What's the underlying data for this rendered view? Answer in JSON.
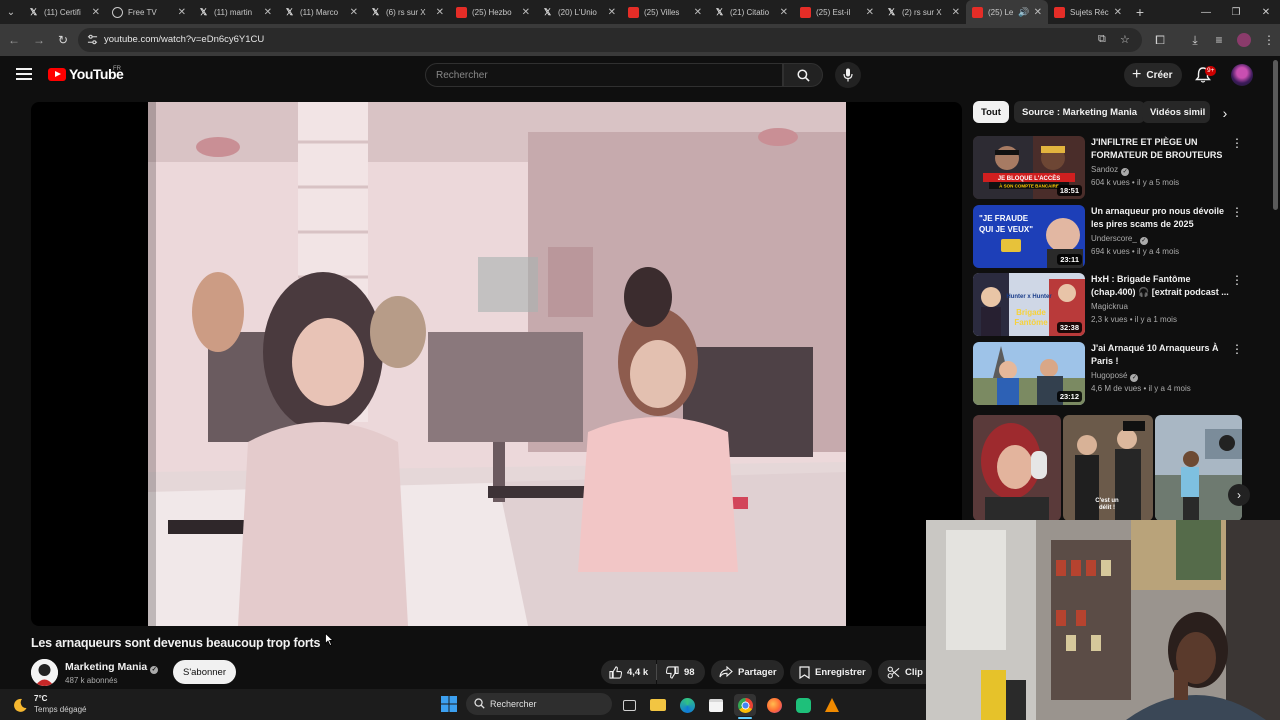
{
  "browser": {
    "tabs": [
      {
        "title": "(11) Certifi",
        "favicon": "x-logo-icon"
      },
      {
        "title": "Free TV",
        "favicon": "globe-icon"
      },
      {
        "title": "(11) martin",
        "favicon": "x-logo-icon"
      },
      {
        "title": "(11) Marco",
        "favicon": "x-logo-icon"
      },
      {
        "title": "(6) rs sur X",
        "favicon": "x-logo-icon"
      },
      {
        "title": "(25) Hezbo",
        "favicon": "youtube-icon"
      },
      {
        "title": "(20) L'Unio",
        "favicon": "x-logo-icon"
      },
      {
        "title": "(25) Villes",
        "favicon": "youtube-icon"
      },
      {
        "title": "(21) Citatio",
        "favicon": "x-logo-icon"
      },
      {
        "title": "(25) Est-il",
        "favicon": "youtube-icon"
      },
      {
        "title": "(2) rs sur X",
        "favicon": "x-logo-icon"
      },
      {
        "title": "(25) Le",
        "favicon": "youtube-icon",
        "active": true
      },
      {
        "title": "Sujets Réc",
        "favicon": "youtube-icon"
      }
    ],
    "url": "youtube.com/watch?v=eDn6cy6Y1CU"
  },
  "youtube": {
    "logo_text": "YouTube",
    "country_code": "FR",
    "search_placeholder": "Rechercher",
    "create_label": "Créer",
    "notifications_badge": "9+"
  },
  "video": {
    "title": "Les arnaqueurs sont devenus beaucoup trop forts",
    "channel": "Marketing Mania",
    "subscribers": "487 k abonnés",
    "subscribe_label": "S'abonner",
    "likes": "4,4 k",
    "dislikes": "98",
    "share_label": "Partager",
    "save_label": "Enregistrer",
    "clip_label": "Clip"
  },
  "sidebar": {
    "chips": [
      "Tout",
      "Source : Marketing Mania",
      "Vidéos simil"
    ],
    "recommended": [
      {
        "title": "J'INFILTRE ET PIÈGE UN FORMATEUR DE BROUTEURS",
        "channel": "Sandoz",
        "verified": true,
        "meta": "604 k vues • il y a 5 mois",
        "duration": "18:51",
        "thumb_text": "JE BLOQUE L'ACCÈS À SON COMPTE BANCAIRE"
      },
      {
        "title": "Un arnaqueur pro nous dévoile les pires scams de 2025",
        "channel": "Underscore_",
        "verified": true,
        "meta": "694 k vues • il y a 4 mois",
        "duration": "23:11",
        "thumb_text": "\"JE FRAUDE QUI JE VEUX\""
      },
      {
        "title": "HxH : Brigade Fantôme (chap.400) 🎧 [extrait podcast ...",
        "channel": "Magickrua",
        "verified": false,
        "meta": "2,3 k vues • il y a 1 mois",
        "duration": "32:38",
        "thumb_text": "Hunter x Hunter Brigade Fantôme"
      },
      {
        "title": "J'ai Arnaqué 10 Arnaqueurs À Paris !",
        "channel": "Hugoposé",
        "verified": true,
        "meta": "4,6 M de vues • il y a 4 mois",
        "duration": "23:12",
        "thumb_text": ""
      }
    ],
    "shorts_caption": "C'est un\ndélit !"
  },
  "taskbar": {
    "weather_temp": "7°C",
    "weather_desc": "Temps dégagé",
    "search_label": "Rechercher"
  },
  "colors": {
    "background": "#0f0f0f",
    "youtube_red": "#ff0000",
    "chip_active": "#f1f1f1",
    "button_bg": "#272727"
  }
}
